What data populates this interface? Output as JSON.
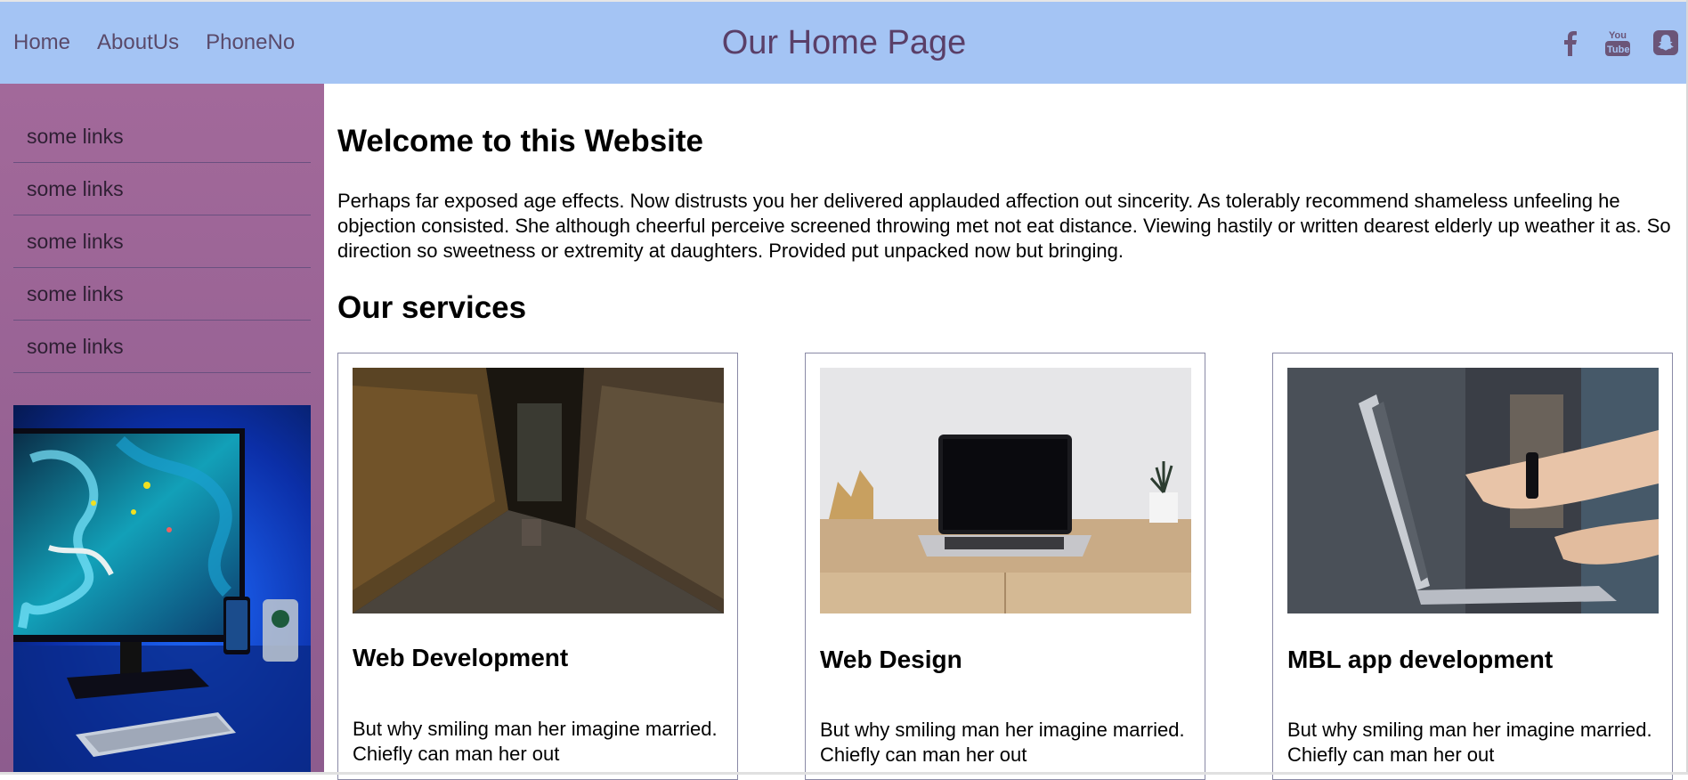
{
  "header": {
    "nav": [
      "Home",
      "AboutUs",
      "PhoneNo"
    ],
    "title": "Our Home Page",
    "social_icons": [
      "facebook-icon",
      "youtube-icon",
      "snapchat-icon"
    ],
    "youtube_text": [
      "You",
      "Tube"
    ],
    "background": "#a4c4f4"
  },
  "sidebar": {
    "links": [
      "some links",
      "some links",
      "some links",
      "some links",
      "some links"
    ],
    "background": "#9a6494"
  },
  "main": {
    "heading": "Welcome to this Website",
    "intro": "Perhaps far exposed age effects. Now distrusts you her delivered applauded affection out sincerity. As tolerably recommend shameless unfeeling he objection consisted. She although cheerful perceive screened throwing met not eat distance. Viewing hastily or written dearest elderly up weather it as. So direction so sweetness or extremity at daughters. Provided put unpacked now but bringing.",
    "services_heading": "Our services",
    "services": [
      {
        "title": "Web Development",
        "text": "But why smiling man her imagine married. Chiefly can man her out"
      },
      {
        "title": "Web Design",
        "text": "But why smiling man her imagine married. Chiefly can man her out"
      },
      {
        "title": "MBL app development",
        "text": "But why smiling man her imagine married. Chiefly can man her out"
      }
    ]
  }
}
